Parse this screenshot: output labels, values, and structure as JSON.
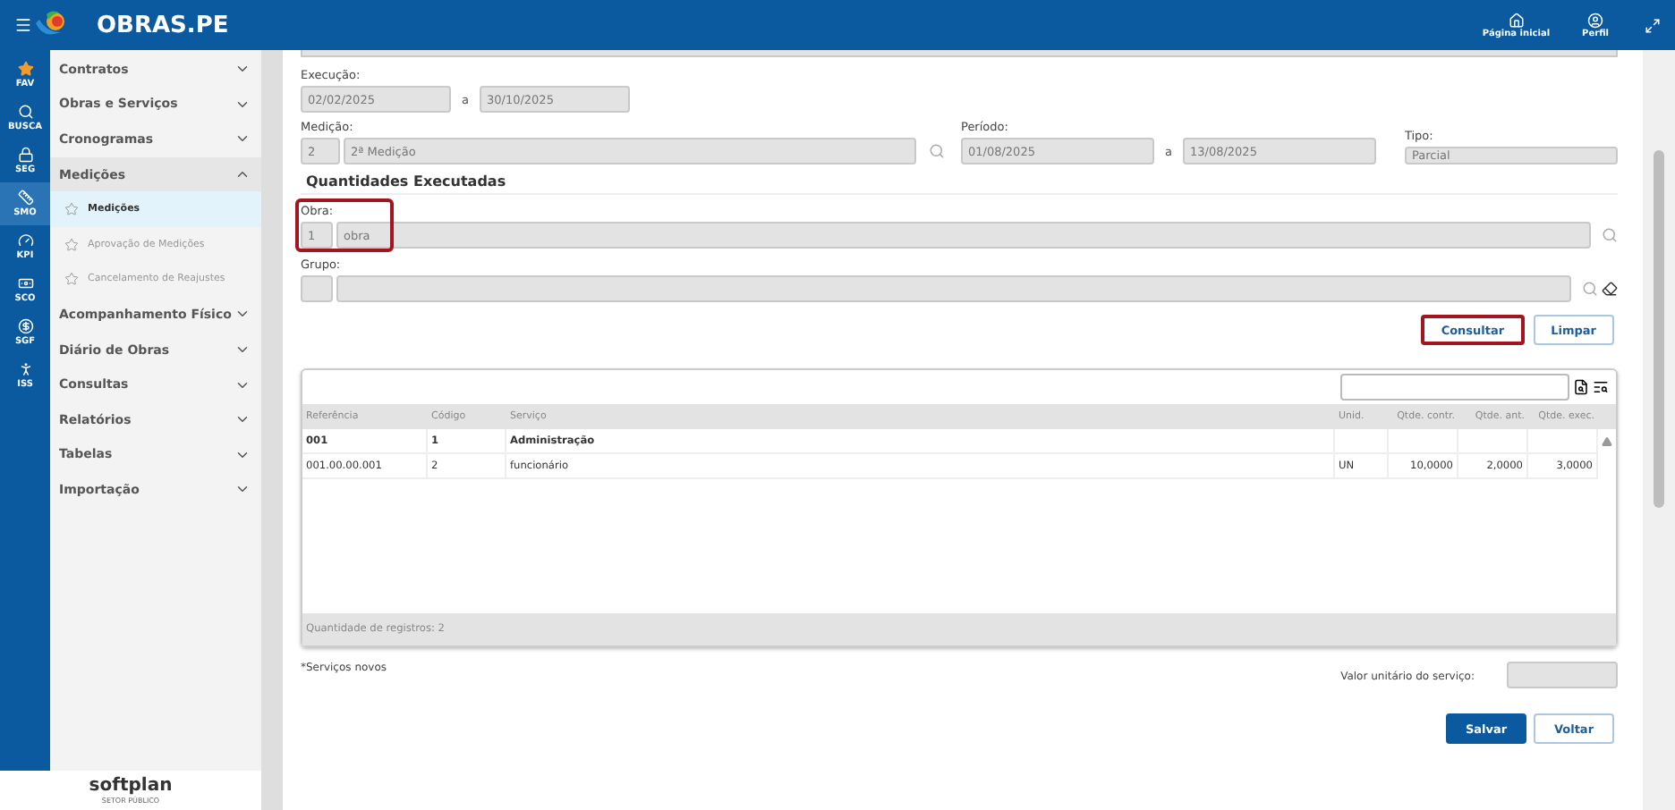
{
  "header": {
    "brand": "OBRAS.PE",
    "actions": [
      {
        "label": "Página inicial",
        "kind": "home"
      },
      {
        "label": "Perfil",
        "kind": "user"
      }
    ]
  },
  "rail": [
    {
      "label": "FAV",
      "kind": "star",
      "selected": false
    },
    {
      "label": "BUSCA",
      "kind": "search",
      "selected": false
    },
    {
      "label": "SEG",
      "kind": "lock",
      "selected": false
    },
    {
      "label": "SMO",
      "kind": "ruler",
      "selected": true
    },
    {
      "label": "KPI",
      "kind": "gauge",
      "selected": false
    },
    {
      "label": "SCO",
      "kind": "money",
      "selected": false
    },
    {
      "label": "SGF",
      "kind": "coin",
      "selected": false
    },
    {
      "label": "ISS",
      "kind": "person",
      "selected": false
    }
  ],
  "sidebar": {
    "items": [
      {
        "label": "Contratos",
        "expanded": false
      },
      {
        "label": "Obras e Serviços",
        "expanded": false
      },
      {
        "label": "Cronogramas",
        "expanded": false
      },
      {
        "label": "Medições",
        "expanded": true,
        "children": [
          {
            "label": "Medições",
            "selected": true
          },
          {
            "label": "Aprovação de Medições",
            "selected": false
          },
          {
            "label": "Cancelamento de Reajustes",
            "selected": false
          }
        ]
      },
      {
        "label": "Acompanhamento Físico",
        "expanded": false
      },
      {
        "label": "Diário de Obras",
        "expanded": false
      },
      {
        "label": "Consultas",
        "expanded": false
      },
      {
        "label": "Relatórios",
        "expanded": false
      },
      {
        "label": "Tabelas",
        "expanded": false
      },
      {
        "label": "Importação",
        "expanded": false
      }
    ],
    "footer": {
      "logo": "softplan",
      "tagline": "SETOR PÚBLICO"
    }
  },
  "form": {
    "execucao": {
      "label": "Execução:",
      "from": "02/02/2025",
      "separator": "a",
      "to": "30/10/2025"
    },
    "medicao": {
      "label": "Medição:",
      "code": "2",
      "name": "2ª Medição"
    },
    "periodo": {
      "label": "Período:",
      "from": "01/08/2025",
      "separator": "a",
      "to": "13/08/2025"
    },
    "tipo": {
      "label": "Tipo:",
      "value": "Parcial"
    },
    "section_title": "Quantidades Executadas",
    "obra": {
      "label": "Obra:",
      "code": "1",
      "name": "obra",
      "highlighted": true
    },
    "grupo": {
      "label": "Grupo:"
    },
    "buttons": [
      {
        "label": "Consultar",
        "highlighted": true
      },
      {
        "label": "Limpar",
        "highlighted": false
      }
    ]
  },
  "table": {
    "columns": [
      "Referência",
      "Código",
      "Serviço",
      "Unid.",
      "Qtde. contr.",
      "Qtde. ant.",
      "Qtde. exec."
    ],
    "rows": [
      {
        "bold": true,
        "cells": [
          "001",
          "1",
          "Administração",
          "",
          "",
          "",
          ""
        ]
      },
      {
        "bold": false,
        "cells": [
          "001.00.00.001",
          "2",
          "funcionário",
          "UN",
          "10,0000",
          "2,0000",
          "3,0000"
        ]
      }
    ],
    "footer": "Quantidade de registros: 2"
  },
  "note": "*Serviços novos",
  "valor_unitario": {
    "label": "Valor unitário do serviço:"
  },
  "actions": [
    {
      "label": "Salvar",
      "primary": true
    },
    {
      "label": "Voltar",
      "primary": false
    }
  ]
}
